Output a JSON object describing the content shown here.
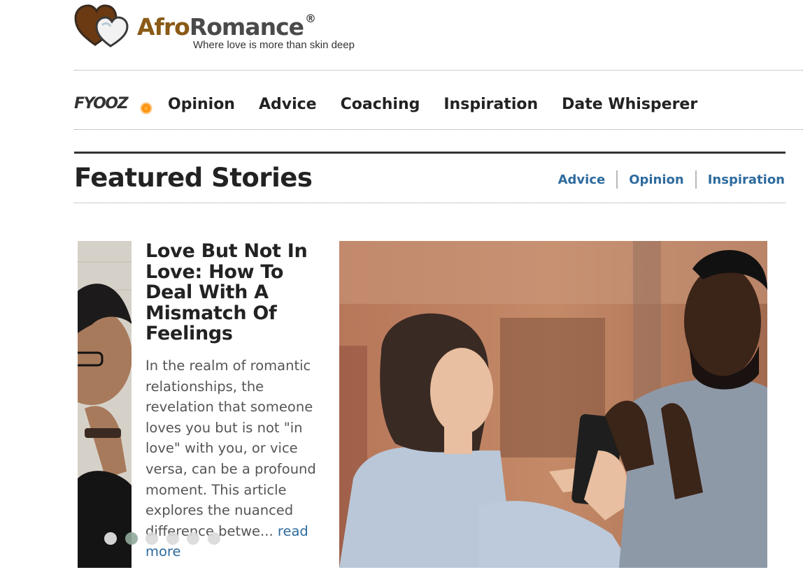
{
  "brand": {
    "name_part1": "Afro",
    "name_part2": "Romance",
    "registered": "®",
    "tagline": "Where love is more than skin deep"
  },
  "nav": {
    "logo_text": "FYOOZ",
    "items": [
      {
        "label": "Opinion"
      },
      {
        "label": "Advice"
      },
      {
        "label": "Coaching"
      },
      {
        "label": "Inspiration"
      },
      {
        "label": "Date Whisperer"
      }
    ]
  },
  "featured": {
    "title": "Featured Stories",
    "categories": [
      {
        "label": "Advice"
      },
      {
        "label": "Opinion"
      },
      {
        "label": "Inspiration"
      }
    ]
  },
  "story": {
    "title": "Love But Not In Love: How To Deal With A Mismatch Of Feelings",
    "excerpt": "In the realm of romantic relationships, the revelation that someone loves you but is not \"in love\" with you, or vice versa, can be a profound moment. This article explores the nuanced difference betwe...",
    "read_more": "read more"
  },
  "carousel": {
    "slide_count": 6,
    "current_index": 1
  },
  "colors": {
    "brand_brown": "#8a5a16",
    "link_blue": "#2e6b9e",
    "text_dark": "#222222"
  }
}
